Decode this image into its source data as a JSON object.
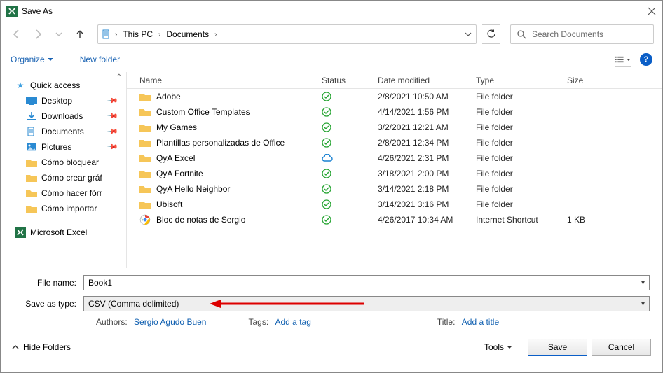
{
  "window": {
    "title": "Save As"
  },
  "breadcrumb": {
    "root": "This PC",
    "current": "Documents"
  },
  "search": {
    "placeholder": "Search Documents"
  },
  "toolbar": {
    "organize": "Organize",
    "newfolder": "New folder"
  },
  "sidebar": {
    "quick": "Quick access",
    "desktop": "Desktop",
    "downloads": "Downloads",
    "documents": "Documents",
    "pictures": "Pictures",
    "f1": "Cómo bloquear",
    "f2": "Cómo crear gráf",
    "f3": "Cómo hacer fórr",
    "f4": "Cómo importar",
    "excel": "Microsoft Excel"
  },
  "columns": {
    "name": "Name",
    "status": "Status",
    "date": "Date modified",
    "type": "Type",
    "size": "Size"
  },
  "rows": [
    {
      "name": "Adobe",
      "status": "ok",
      "date": "2/8/2021 10:50 AM",
      "type": "File folder",
      "size": ""
    },
    {
      "name": "Custom Office Templates",
      "status": "ok",
      "date": "4/14/2021 1:56 PM",
      "type": "File folder",
      "size": ""
    },
    {
      "name": "My Games",
      "status": "ok",
      "date": "3/2/2021 12:21 AM",
      "type": "File folder",
      "size": ""
    },
    {
      "name": "Plantillas personalizadas de Office",
      "status": "ok",
      "date": "2/8/2021 12:34 PM",
      "type": "File folder",
      "size": ""
    },
    {
      "name": "QyA Excel",
      "status": "cloud",
      "date": "4/26/2021 2:31 PM",
      "type": "File folder",
      "size": ""
    },
    {
      "name": "QyA Fortnite",
      "status": "ok",
      "date": "3/18/2021 2:00 PM",
      "type": "File folder",
      "size": ""
    },
    {
      "name": "QyA Hello Neighbor",
      "status": "ok",
      "date": "3/14/2021 2:18 PM",
      "type": "File folder",
      "size": ""
    },
    {
      "name": "Ubisoft",
      "status": "ok",
      "date": "3/14/2021 3:16 PM",
      "type": "File folder",
      "size": ""
    },
    {
      "name": "Bloc de notas de Sergio",
      "status": "ok",
      "date": "4/26/2017 10:34 AM",
      "type": "Internet Shortcut",
      "size": "1 KB"
    }
  ],
  "file": {
    "name_label": "File name:",
    "name_value": "Book1",
    "type_label": "Save as type:",
    "type_value": "CSV (Comma delimited)"
  },
  "meta": {
    "authors_label": "Authors:",
    "authors_value": "Sergio Agudo Buen",
    "tags_label": "Tags:",
    "tags_value": "Add a tag",
    "title_label": "Title:",
    "title_value": "Add a title"
  },
  "footer": {
    "hide": "Hide Folders",
    "tools": "Tools",
    "save": "Save",
    "cancel": "Cancel"
  }
}
